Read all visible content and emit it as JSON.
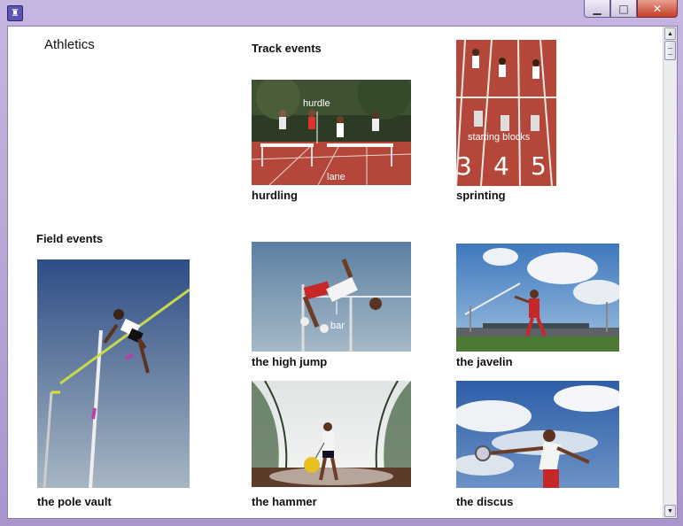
{
  "window": {
    "icon": "app-icon"
  },
  "page": {
    "title": "Athletics"
  },
  "track": {
    "heading": "Track events",
    "hurdling": {
      "caption": "hurdling",
      "label_hurdle": "hurdle",
      "label_lane": "lane"
    },
    "sprinting": {
      "caption": "sprinting",
      "label_blocks": "starting blocks",
      "lane_numbers": [
        "3",
        "4",
        "5"
      ]
    }
  },
  "field": {
    "heading": "Field events",
    "pole_vault": {
      "caption": "the pole vault"
    },
    "high_jump": {
      "caption": "the high jump",
      "label_bar": "bar"
    },
    "javelin": {
      "caption": "the javelin"
    },
    "hammer": {
      "caption": "the hammer"
    },
    "discus": {
      "caption": "the discus"
    }
  },
  "colors": {
    "track_red": "#b5473a",
    "sky_blue": "#5a86c2",
    "grass": "#3c6b2f"
  }
}
